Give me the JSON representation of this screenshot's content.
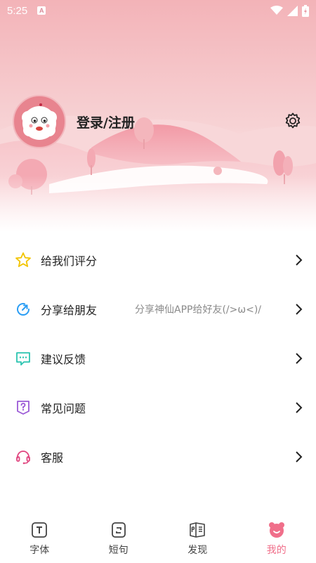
{
  "status_bar": {
    "time": "5:25",
    "notification_badge": "A"
  },
  "profile": {
    "login_label": "登录/注册"
  },
  "menu": [
    {
      "label": "给我们评分",
      "subtitle": "",
      "icon": "star-icon"
    },
    {
      "label": "分享给朋友",
      "subtitle": "分享神仙APP给好友(/>ω<)/",
      "icon": "share-icon"
    },
    {
      "label": "建议反馈",
      "subtitle": "",
      "icon": "feedback-icon"
    },
    {
      "label": "常见问题",
      "subtitle": "",
      "icon": "question-icon"
    },
    {
      "label": "客服",
      "subtitle": "",
      "icon": "headset-icon"
    }
  ],
  "bottom_nav": [
    {
      "label": "字体",
      "icon": "font-icon",
      "active": false
    },
    {
      "label": "短句",
      "icon": "quote-icon",
      "active": false
    },
    {
      "label": "发现",
      "icon": "discover-icon",
      "active": false
    },
    {
      "label": "我的",
      "icon": "bear-icon",
      "active": true
    }
  ],
  "colors": {
    "accent": "#f06f8a",
    "header_pink": "#f2aeb4",
    "star": "#f2c400",
    "share": "#2a9df4",
    "feedback": "#2bc4b0",
    "question": "#9b59d6",
    "headset": "#e0457f"
  }
}
